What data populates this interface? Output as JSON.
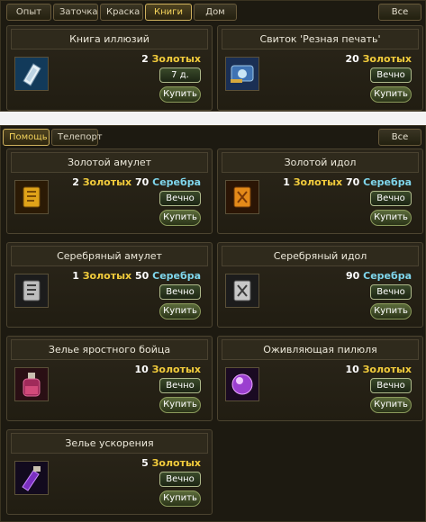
{
  "panel1": {
    "tabs": [
      {
        "label": "Опыт",
        "active": false
      },
      {
        "label": "Заточка",
        "active": false
      },
      {
        "label": "Краска",
        "active": false
      },
      {
        "label": "Книги",
        "active": true
      },
      {
        "label": "Дом",
        "active": false
      }
    ],
    "all_label": "Все",
    "items": [
      {
        "name": "Книга иллюзий",
        "icon": "illusion-book-icon",
        "price": [
          {
            "amount": "2",
            "currency": "Золотых",
            "type": "gold"
          }
        ],
        "duration": "7 д.",
        "buy": "Купить"
      },
      {
        "name": "Свиток 'Резная печать'",
        "icon": "carved-seal-scroll-icon",
        "price": [
          {
            "amount": "20",
            "currency": "Золотых",
            "type": "gold"
          }
        ],
        "duration": "Вечно",
        "buy": "Купить"
      }
    ]
  },
  "panel2": {
    "tabs": [
      {
        "label": "Помощь",
        "active": true
      },
      {
        "label": "Телепорт",
        "active": false
      }
    ],
    "all_label": "Все",
    "items": [
      {
        "name": "Золотой амулет",
        "icon": "gold-amulet-icon",
        "price": [
          {
            "amount": "2",
            "currency": "Золотых",
            "type": "gold"
          },
          {
            "amount": "70",
            "currency": "Серебра",
            "type": "silver"
          }
        ],
        "duration": "Вечно",
        "buy": "Купить"
      },
      {
        "name": "Золотой идол",
        "icon": "gold-idol-icon",
        "price": [
          {
            "amount": "1",
            "currency": "Золотых",
            "type": "gold"
          },
          {
            "amount": "70",
            "currency": "Серебра",
            "type": "silver"
          }
        ],
        "duration": "Вечно",
        "buy": "Купить"
      },
      {
        "name": "Серебряный амулет",
        "icon": "silver-amulet-icon",
        "price": [
          {
            "amount": "1",
            "currency": "Золотых",
            "type": "gold"
          },
          {
            "amount": "50",
            "currency": "Серебра",
            "type": "silver"
          }
        ],
        "duration": "Вечно",
        "buy": "Купить"
      },
      {
        "name": "Серебряный идол",
        "icon": "silver-idol-icon",
        "price": [
          {
            "amount": "90",
            "currency": "Серебра",
            "type": "silver"
          }
        ],
        "duration": "Вечно",
        "buy": "Купить"
      },
      {
        "name": "Зелье яростного бойца",
        "icon": "fury-potion-icon",
        "price": [
          {
            "amount": "10",
            "currency": "Золотых",
            "type": "gold"
          }
        ],
        "duration": "Вечно",
        "buy": "Купить"
      },
      {
        "name": "Оживляющая пилюля",
        "icon": "revival-pill-icon",
        "price": [
          {
            "amount": "10",
            "currency": "Золотых",
            "type": "gold"
          }
        ],
        "duration": "Вечно",
        "buy": "Купить"
      },
      {
        "name": "Зелье ускорения",
        "icon": "speed-potion-icon",
        "price": [
          {
            "amount": "5",
            "currency": "Золотых",
            "type": "gold"
          }
        ],
        "duration": "Вечно",
        "buy": "Купить"
      }
    ]
  },
  "colors": {
    "gold_currency": "#f2cc3c",
    "silver_currency": "#7fd6ec",
    "active_tab": "#f4d35b",
    "background": "#1d1a11"
  }
}
